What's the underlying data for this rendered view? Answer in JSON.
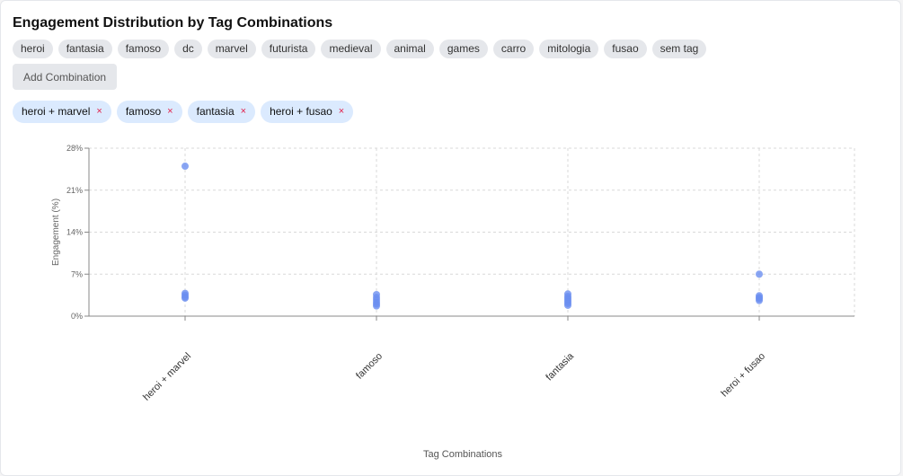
{
  "title": "Engagement Distribution by Tag Combinations",
  "tags": [
    "heroi",
    "fantasia",
    "famoso",
    "dc",
    "marvel",
    "futurista",
    "medieval",
    "animal",
    "games",
    "carro",
    "mitologia",
    "fusao",
    "sem tag"
  ],
  "add_button_label": "Add Combination",
  "remove_glyph": "×",
  "combinations": [
    "heroi + marvel",
    "famoso",
    "fantasia",
    "heroi + fusao"
  ],
  "colors": {
    "point": "#6b8ff0",
    "grid": "#d9d9d9",
    "axis": "#888888"
  },
  "chart_data": {
    "type": "scatter",
    "title": "",
    "xlabel": "Tag Combinations",
    "ylabel": "Engagement (%)",
    "categories": [
      "heroi + marvel",
      "famoso",
      "fantasia",
      "heroi + fusao"
    ],
    "ylim": [
      0,
      28
    ],
    "yticks": [
      0,
      7,
      14,
      21,
      28
    ],
    "ytick_labels": [
      "0%",
      "7%",
      "14%",
      "21%",
      "28%"
    ],
    "grid": true,
    "points": [
      {
        "category": "heroi + marvel",
        "values": [
          25.0,
          3.8,
          3.5,
          3.2,
          3.0
        ]
      },
      {
        "category": "famoso",
        "values": [
          3.6,
          3.1,
          2.7,
          2.3,
          2.0,
          1.7
        ]
      },
      {
        "category": "fantasia",
        "values": [
          3.7,
          3.3,
          3.0,
          2.7,
          2.4,
          2.1,
          1.8
        ]
      },
      {
        "category": "heroi + fusao",
        "values": [
          7.0,
          3.4,
          3.1,
          2.9,
          2.6
        ]
      }
    ]
  }
}
